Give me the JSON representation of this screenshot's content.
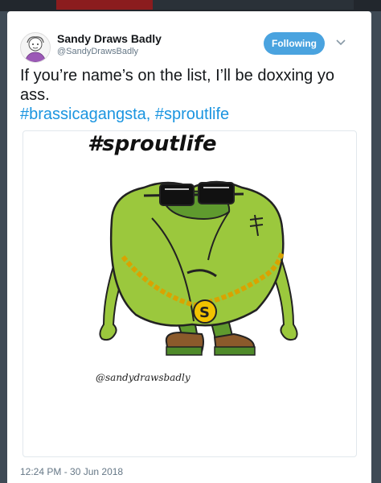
{
  "tweet": {
    "author_name": "Sandy Draws Badly",
    "author_handle": "@SandyDrawsBadly",
    "follow_label": "Following",
    "text": "If you’re name’s on the list, I’ll be doxxing yo ass.",
    "hashtags": "#brassicagangsta, #sproutlife",
    "timestamp": "12:24 PM - 30 Jun 2018"
  },
  "image": {
    "drawing_title": "#sproutlife",
    "signature": "@sandydrawsbadly"
  },
  "colors": {
    "accent": "#1b95e0",
    "follow_button": "#4aa3df",
    "sprout_green": "#9bc83d",
    "sprout_dark": "#5f9a2e",
    "chain_gold": "#d9a300"
  },
  "icons": [
    "avatar",
    "chevron-down-icon"
  ]
}
